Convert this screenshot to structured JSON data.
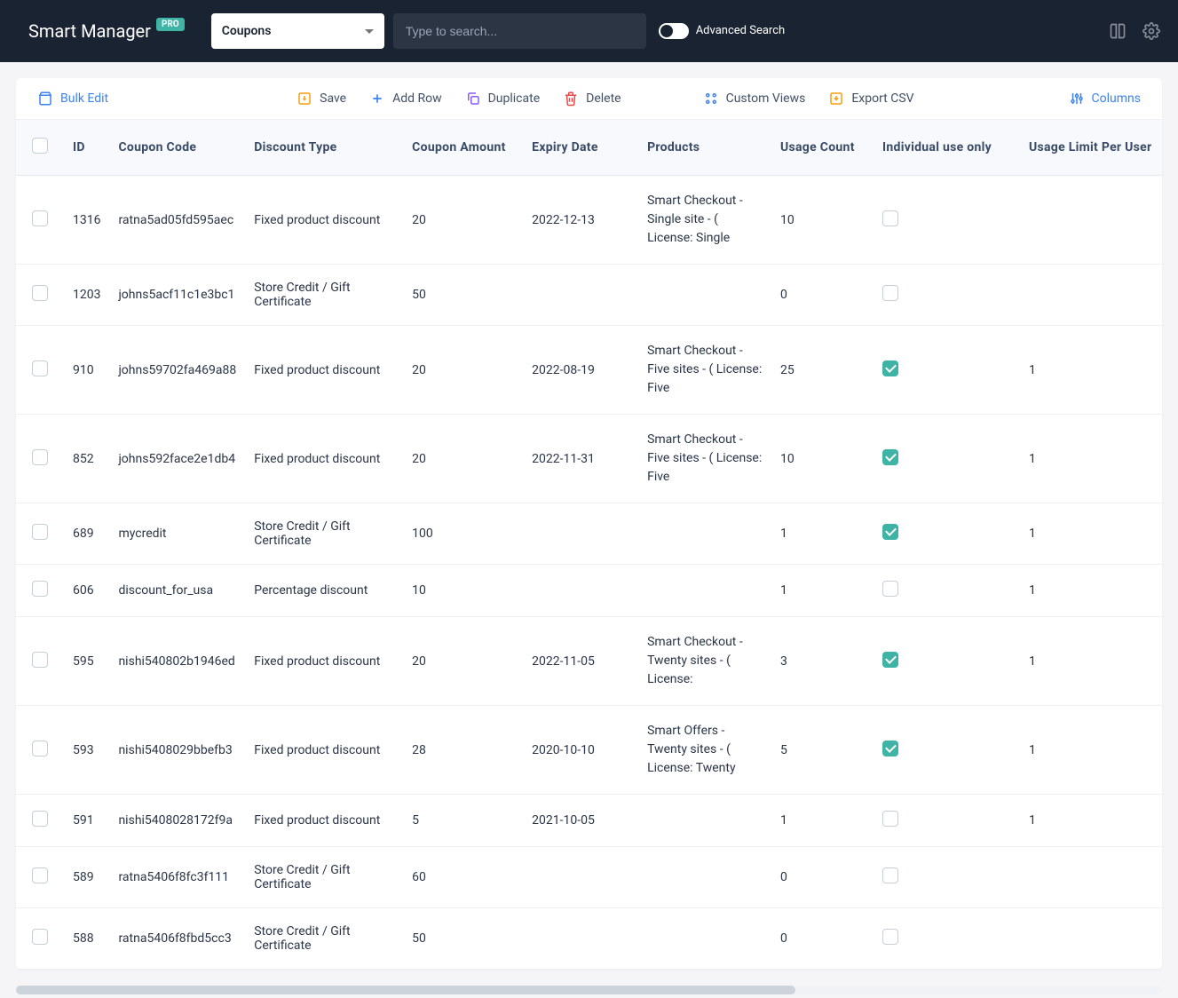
{
  "header": {
    "brand": "Smart Manager",
    "badge": "PRO",
    "dashboard_select": "Coupons",
    "search_placeholder": "Type to search...",
    "advanced_toggle_label": "Advanced Search"
  },
  "toolbar": {
    "bulk_edit": "Bulk Edit",
    "save": "Save",
    "add_row": "Add Row",
    "duplicate": "Duplicate",
    "delete": "Delete",
    "custom_views": "Custom Views",
    "export_csv": "Export CSV",
    "columns": "Columns"
  },
  "columns": [
    "ID",
    "Coupon Code",
    "Discount Type",
    "Coupon Amount",
    "Expiry Date",
    "Products",
    "Usage Count",
    "Individual use only",
    "Usage Limit Per User"
  ],
  "rows": [
    {
      "id": "1316",
      "code": "ratna5ad05fd595aec",
      "type": "Fixed product discount",
      "amount": "20",
      "expiry": "2022-12-13",
      "products": "Smart Checkout - Single site - ( License: Single",
      "usage": "10",
      "individual": false,
      "limit": ""
    },
    {
      "id": "1203",
      "code": "johns5acf11c1e3bc1",
      "type": "Store Credit / Gift Certificate",
      "amount": "50",
      "expiry": "",
      "products": "",
      "usage": "0",
      "individual": false,
      "limit": ""
    },
    {
      "id": "910",
      "code": "johns59702fa469a88",
      "type": "Fixed product discount",
      "amount": "20",
      "expiry": "2022-08-19",
      "products": "Smart Checkout - Five sites - ( License: Five",
      "usage": "25",
      "individual": true,
      "limit": "1"
    },
    {
      "id": "852",
      "code": "johns592face2e1db4",
      "type": "Fixed product discount",
      "amount": "20",
      "expiry": "2022-11-31",
      "products": "Smart Checkout - Five sites - ( License: Five",
      "usage": "10",
      "individual": true,
      "limit": "1"
    },
    {
      "id": "689",
      "code": "mycredit",
      "type": "Store Credit / Gift Certificate",
      "amount": "100",
      "expiry": "",
      "products": "",
      "usage": "1",
      "individual": true,
      "limit": "1"
    },
    {
      "id": "606",
      "code": "discount_for_usa",
      "type": "Percentage discount",
      "amount": "10",
      "expiry": "",
      "products": "",
      "usage": "1",
      "individual": false,
      "limit": "1"
    },
    {
      "id": "595",
      "code": "nishi540802b1946ed",
      "type": "Fixed product discount",
      "amount": "20",
      "expiry": "2022-11-05",
      "products": "Smart Checkout - Twenty sites - ( License:",
      "usage": "3",
      "individual": true,
      "limit": "1"
    },
    {
      "id": "593",
      "code": "nishi5408029bbefb3",
      "type": "Fixed product discount",
      "amount": "28",
      "expiry": "2020-10-10",
      "products": "Smart Offers - Twenty sites - ( License: Twenty",
      "usage": "5",
      "individual": true,
      "limit": "1"
    },
    {
      "id": "591",
      "code": "nishi5408028172f9a",
      "type": "Fixed product discount",
      "amount": "5",
      "expiry": "2021-10-05",
      "products": "",
      "usage": "1",
      "individual": false,
      "limit": "1"
    },
    {
      "id": "589",
      "code": "ratna5406f8fc3f111",
      "type": "Store Credit / Gift Certificate",
      "amount": "60",
      "expiry": "",
      "products": "",
      "usage": "0",
      "individual": false,
      "limit": ""
    },
    {
      "id": "588",
      "code": "ratna5406f8fbd5cc3",
      "type": "Store Credit / Gift Certificate",
      "amount": "50",
      "expiry": "",
      "products": "",
      "usage": "0",
      "individual": false,
      "limit": ""
    }
  ]
}
